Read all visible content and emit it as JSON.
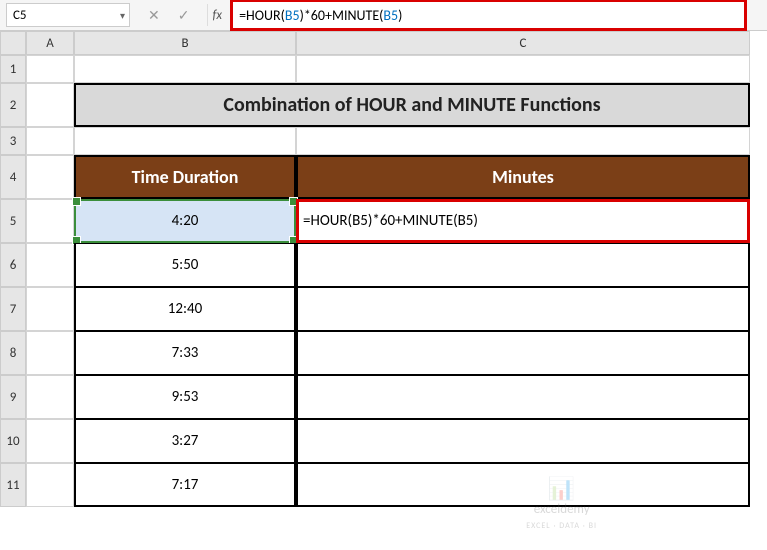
{
  "namebox": {
    "value": "C5"
  },
  "formula_bar": {
    "fx_label": "fx",
    "prefix": "=HOUR(",
    "ref1": "B5",
    "mid": ")*60+MINUTE(",
    "ref2": "B5",
    "suffix": ")"
  },
  "columns": {
    "A": "A",
    "B": "B",
    "C": "C"
  },
  "rows": {
    "r1": "1",
    "r2": "2",
    "r3": "3",
    "r4": "4",
    "r5": "5",
    "r6": "6",
    "r7": "7",
    "r8": "8",
    "r9": "9",
    "r10": "10",
    "r11": "11"
  },
  "title": "Combination of HOUR and MINUTE Functions",
  "headers": {
    "B": "Time Duration",
    "C": "Minutes"
  },
  "cells": {
    "B5": "4:20",
    "B6": "5:50",
    "B7": "12:40",
    "B8": "7:33",
    "B9": "9:53",
    "B10": "3:27",
    "B11": "7:17",
    "C5": "=HOUR(B5)*60+MINUTE(B5)"
  },
  "watermark": {
    "brand": "exceldemy",
    "tagline": "EXCEL · DATA · BI"
  },
  "chart_data": {
    "type": "table",
    "title": "Combination of HOUR and MINUTE Functions",
    "columns": [
      "Time Duration",
      "Minutes"
    ],
    "rows": [
      [
        "4:20",
        "=HOUR(B5)*60+MINUTE(B5)"
      ],
      [
        "5:50",
        ""
      ],
      [
        "12:40",
        ""
      ],
      [
        "7:33",
        ""
      ],
      [
        "9:53",
        ""
      ],
      [
        "3:27",
        ""
      ],
      [
        "7:17",
        ""
      ]
    ]
  }
}
